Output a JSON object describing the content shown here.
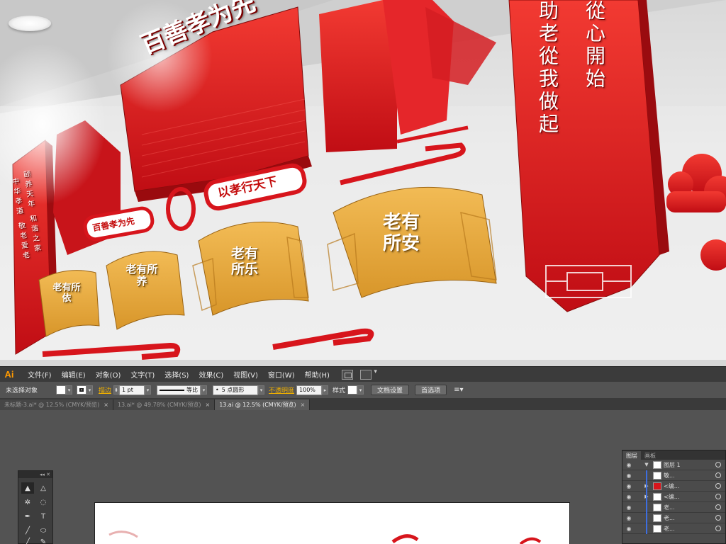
{
  "render": {
    "headline": "百善孝为先",
    "banner_left": "百善孝为先",
    "banner_mid": "以孝行天下",
    "scroll_left_col1": "中华孝道 敬老爱老",
    "scroll_left_col2": "颐养天年 和谐之家",
    "scroll_right_col1": "從心開始",
    "scroll_right_col2": "助老從我做起",
    "fans": [
      {
        "label": "老有所依"
      },
      {
        "label": "老有所养"
      },
      {
        "label": "老有所乐"
      },
      {
        "label": "老有所安"
      }
    ]
  },
  "menubar": {
    "logo": "Ai",
    "items": [
      "文件(F)",
      "编辑(E)",
      "对象(O)",
      "文字(T)",
      "选择(S)",
      "效果(C)",
      "视图(V)",
      "窗口(W)",
      "帮助(H)"
    ]
  },
  "controlbar": {
    "selection": "未选择对象",
    "stroke_label": "描边",
    "stroke_weight": "1 pt",
    "stroke_profile": "等比",
    "brush": "5 点圆形",
    "opacity_label": "不透明度",
    "opacity_value": "100%",
    "style_label": "样式",
    "doc_setup": "文档设置",
    "preferences": "首选项"
  },
  "tabs": [
    {
      "label": "未标题-3.ai* @ 12.5% (CMYK/预览)",
      "active": false
    },
    {
      "label": "13.ai* @ 49.78% (CMYK/预览)",
      "active": false
    },
    {
      "label": "13.ai @ 12.5% (CMYK/预览)",
      "active": true
    }
  ],
  "layers_panel": {
    "tab_layers": "图层",
    "tab_artboards": "画板",
    "rows": [
      {
        "name": "图层 1"
      },
      {
        "name": "敬..."
      },
      {
        "name": "<编..."
      },
      {
        "name": "<编..."
      },
      {
        "name": "老..."
      },
      {
        "name": "老..."
      },
      {
        "name": "老..."
      }
    ]
  },
  "colors": {
    "red": "#d8141c",
    "gold": "#e0a53a",
    "ui_dark": "#3b3b3b",
    "ui_mid": "#535353",
    "ai_orange": "#ff9a00"
  }
}
